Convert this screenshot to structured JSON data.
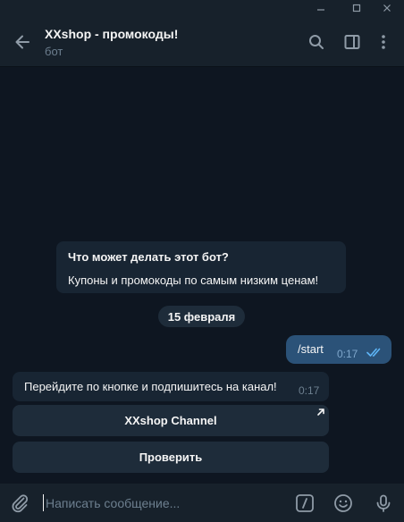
{
  "window": {
    "controls": [
      "minimize",
      "maximize",
      "close"
    ]
  },
  "header": {
    "title": "XXshop - промокоды!",
    "subtitle": "бот",
    "icons": [
      "back-arrow-icon",
      "search-icon",
      "sidebar-toggle-icon",
      "more-vertical-icon"
    ]
  },
  "bot_info": {
    "title": "Что может делать этот бот?",
    "description": "Купоны и промокоды по самым низким ценам!"
  },
  "date_separator": "15 февраля",
  "messages": [
    {
      "direction": "out",
      "text": "/start",
      "time": "0:17",
      "status": "read"
    },
    {
      "direction": "in",
      "text": "Перейдите по кнопке и подпишитесь на канал!",
      "time": "0:17"
    }
  ],
  "inline_keyboard": [
    {
      "label": "XXshop Channel",
      "type": "url"
    },
    {
      "label": "Проверить",
      "type": "callback"
    }
  ],
  "composer": {
    "placeholder": "Написать сообщение...",
    "value": "",
    "icons": [
      "attach-icon",
      "commands-icon",
      "emoji-icon",
      "microphone-icon"
    ]
  },
  "colors": {
    "background": "#0e1621",
    "header": "#17212b",
    "incoming_bubble": "#182533",
    "outgoing_bubble": "#2b5278",
    "accent": "#5eb5f7"
  }
}
